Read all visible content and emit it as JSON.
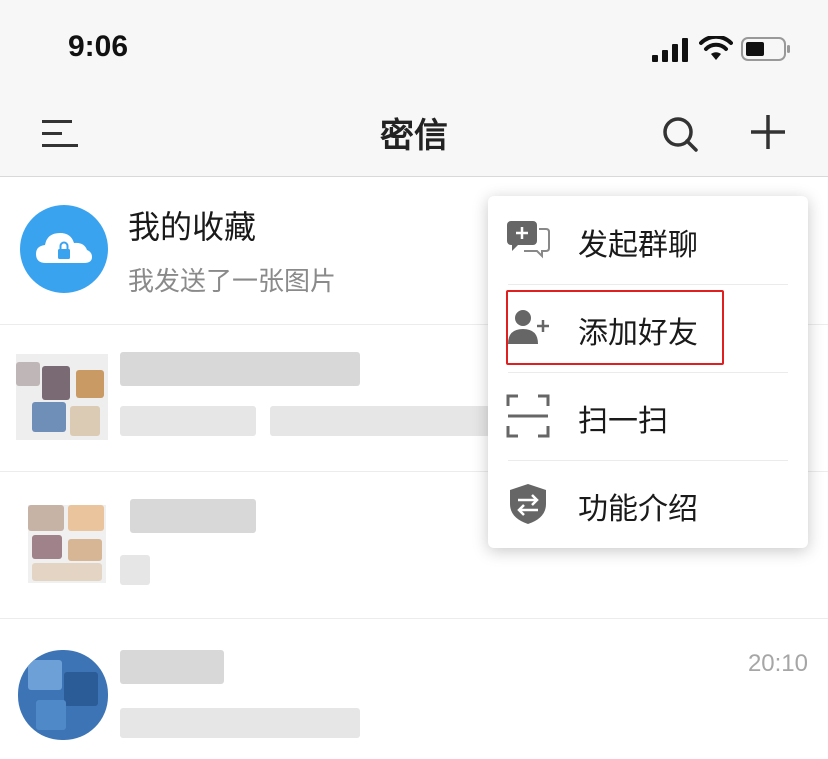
{
  "status_bar": {
    "time": "9:06"
  },
  "nav": {
    "title": "密信"
  },
  "chats": [
    {
      "name": "我的收藏",
      "preview": "我发送了一张图片",
      "time": ""
    },
    {
      "name": "",
      "preview": "",
      "time": ""
    },
    {
      "name": "",
      "preview": "",
      "time": ""
    },
    {
      "name": "",
      "preview": "",
      "time": "20:10"
    }
  ],
  "popup_menu": {
    "items": [
      {
        "label": "发起群聊",
        "icon": "group-chat-icon"
      },
      {
        "label": "添加好友",
        "icon": "add-friend-icon"
      },
      {
        "label": "扫一扫",
        "icon": "scan-icon"
      },
      {
        "label": "功能介绍",
        "icon": "feature-intro-icon"
      }
    ],
    "highlighted_index": 1
  },
  "colors": {
    "accent": "#39a3f0",
    "highlight_border": "#e02020",
    "bar_background": "#f7f7f7",
    "icon_gray": "#666666"
  }
}
